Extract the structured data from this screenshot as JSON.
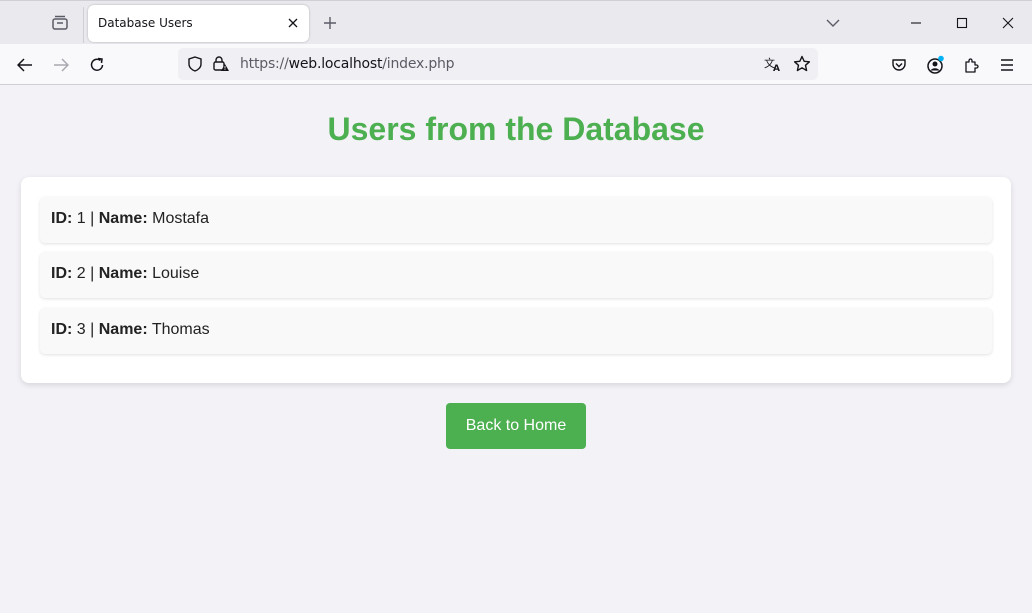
{
  "browser": {
    "tab_title": "Database Users",
    "url_scheme": "https://",
    "url_host": "web.localhost",
    "url_path": "/index.php",
    "accent_color": "#00b3f4"
  },
  "page": {
    "title": "Users from the Database",
    "title_color": "#4caf50",
    "id_label": "ID:",
    "separator": "|",
    "name_label": "Name:",
    "users": [
      {
        "id": "1",
        "name": "Mostafa"
      },
      {
        "id": "2",
        "name": "Louise"
      },
      {
        "id": "3",
        "name": "Thomas"
      }
    ],
    "back_button_label": "Back to Home",
    "button_color": "#4caf50"
  }
}
